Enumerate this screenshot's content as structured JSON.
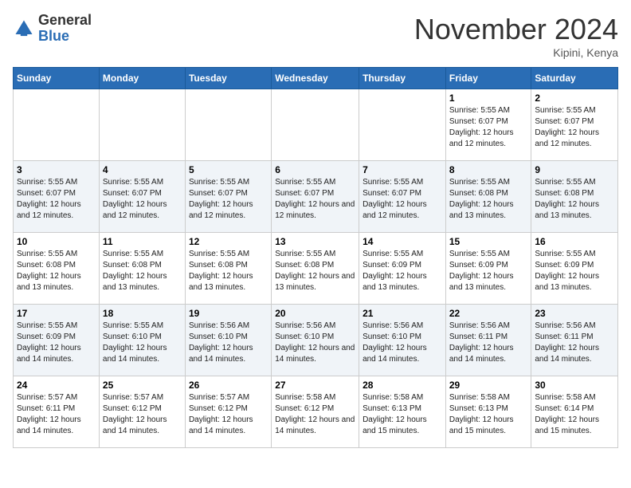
{
  "header": {
    "logo_general": "General",
    "logo_blue": "Blue",
    "month_title": "November 2024",
    "location": "Kipini, Kenya"
  },
  "weekdays": [
    "Sunday",
    "Monday",
    "Tuesday",
    "Wednesday",
    "Thursday",
    "Friday",
    "Saturday"
  ],
  "weeks": [
    [
      {
        "day": "",
        "info": ""
      },
      {
        "day": "",
        "info": ""
      },
      {
        "day": "",
        "info": ""
      },
      {
        "day": "",
        "info": ""
      },
      {
        "day": "",
        "info": ""
      },
      {
        "day": "1",
        "info": "Sunrise: 5:55 AM\nSunset: 6:07 PM\nDaylight: 12 hours and 12 minutes."
      },
      {
        "day": "2",
        "info": "Sunrise: 5:55 AM\nSunset: 6:07 PM\nDaylight: 12 hours and 12 minutes."
      }
    ],
    [
      {
        "day": "3",
        "info": "Sunrise: 5:55 AM\nSunset: 6:07 PM\nDaylight: 12 hours and 12 minutes."
      },
      {
        "day": "4",
        "info": "Sunrise: 5:55 AM\nSunset: 6:07 PM\nDaylight: 12 hours and 12 minutes."
      },
      {
        "day": "5",
        "info": "Sunrise: 5:55 AM\nSunset: 6:07 PM\nDaylight: 12 hours and 12 minutes."
      },
      {
        "day": "6",
        "info": "Sunrise: 5:55 AM\nSunset: 6:07 PM\nDaylight: 12 hours and 12 minutes."
      },
      {
        "day": "7",
        "info": "Sunrise: 5:55 AM\nSunset: 6:07 PM\nDaylight: 12 hours and 12 minutes."
      },
      {
        "day": "8",
        "info": "Sunrise: 5:55 AM\nSunset: 6:08 PM\nDaylight: 12 hours and 13 minutes."
      },
      {
        "day": "9",
        "info": "Sunrise: 5:55 AM\nSunset: 6:08 PM\nDaylight: 12 hours and 13 minutes."
      }
    ],
    [
      {
        "day": "10",
        "info": "Sunrise: 5:55 AM\nSunset: 6:08 PM\nDaylight: 12 hours and 13 minutes."
      },
      {
        "day": "11",
        "info": "Sunrise: 5:55 AM\nSunset: 6:08 PM\nDaylight: 12 hours and 13 minutes."
      },
      {
        "day": "12",
        "info": "Sunrise: 5:55 AM\nSunset: 6:08 PM\nDaylight: 12 hours and 13 minutes."
      },
      {
        "day": "13",
        "info": "Sunrise: 5:55 AM\nSunset: 6:08 PM\nDaylight: 12 hours and 13 minutes."
      },
      {
        "day": "14",
        "info": "Sunrise: 5:55 AM\nSunset: 6:09 PM\nDaylight: 12 hours and 13 minutes."
      },
      {
        "day": "15",
        "info": "Sunrise: 5:55 AM\nSunset: 6:09 PM\nDaylight: 12 hours and 13 minutes."
      },
      {
        "day": "16",
        "info": "Sunrise: 5:55 AM\nSunset: 6:09 PM\nDaylight: 12 hours and 13 minutes."
      }
    ],
    [
      {
        "day": "17",
        "info": "Sunrise: 5:55 AM\nSunset: 6:09 PM\nDaylight: 12 hours and 14 minutes."
      },
      {
        "day": "18",
        "info": "Sunrise: 5:55 AM\nSunset: 6:10 PM\nDaylight: 12 hours and 14 minutes."
      },
      {
        "day": "19",
        "info": "Sunrise: 5:56 AM\nSunset: 6:10 PM\nDaylight: 12 hours and 14 minutes."
      },
      {
        "day": "20",
        "info": "Sunrise: 5:56 AM\nSunset: 6:10 PM\nDaylight: 12 hours and 14 minutes."
      },
      {
        "day": "21",
        "info": "Sunrise: 5:56 AM\nSunset: 6:10 PM\nDaylight: 12 hours and 14 minutes."
      },
      {
        "day": "22",
        "info": "Sunrise: 5:56 AM\nSunset: 6:11 PM\nDaylight: 12 hours and 14 minutes."
      },
      {
        "day": "23",
        "info": "Sunrise: 5:56 AM\nSunset: 6:11 PM\nDaylight: 12 hours and 14 minutes."
      }
    ],
    [
      {
        "day": "24",
        "info": "Sunrise: 5:57 AM\nSunset: 6:11 PM\nDaylight: 12 hours and 14 minutes."
      },
      {
        "day": "25",
        "info": "Sunrise: 5:57 AM\nSunset: 6:12 PM\nDaylight: 12 hours and 14 minutes."
      },
      {
        "day": "26",
        "info": "Sunrise: 5:57 AM\nSunset: 6:12 PM\nDaylight: 12 hours and 14 minutes."
      },
      {
        "day": "27",
        "info": "Sunrise: 5:58 AM\nSunset: 6:12 PM\nDaylight: 12 hours and 14 minutes."
      },
      {
        "day": "28",
        "info": "Sunrise: 5:58 AM\nSunset: 6:13 PM\nDaylight: 12 hours and 15 minutes."
      },
      {
        "day": "29",
        "info": "Sunrise: 5:58 AM\nSunset: 6:13 PM\nDaylight: 12 hours and 15 minutes."
      },
      {
        "day": "30",
        "info": "Sunrise: 5:58 AM\nSunset: 6:14 PM\nDaylight: 12 hours and 15 minutes."
      }
    ]
  ]
}
